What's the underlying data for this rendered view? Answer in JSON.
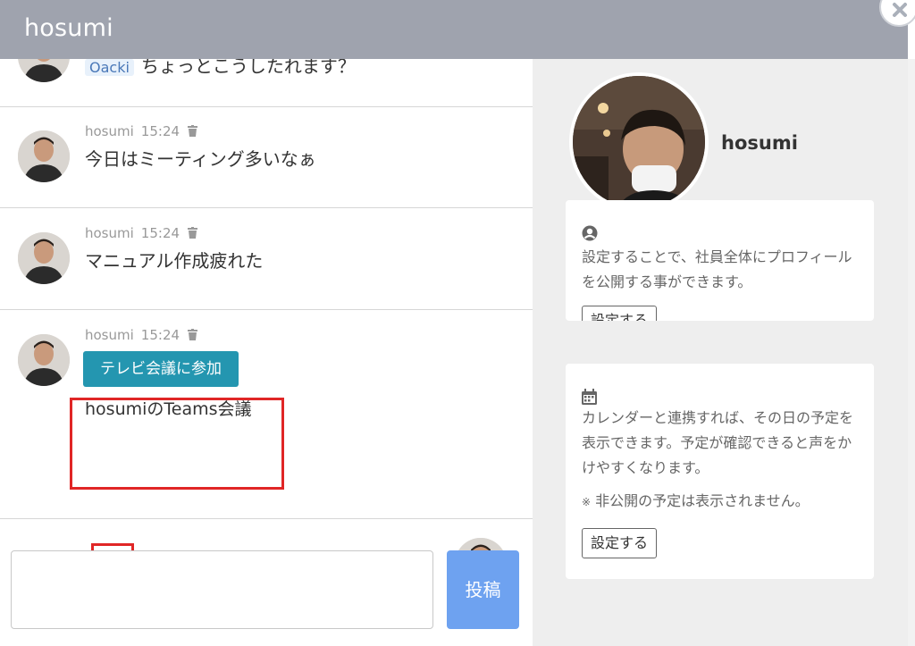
{
  "header": {
    "title": "hosumi"
  },
  "messages": [
    {
      "partial_tag": "Oacki",
      "partial_text": "ちょっとこうしたれます？"
    },
    {
      "author": "hosumi",
      "time": "15:24",
      "text": "今日はミーティング多いなぁ"
    },
    {
      "author": "hosumi",
      "time": "15:24",
      "text": "マニュアル作成疲れた"
    },
    {
      "author": "hosumi",
      "time": "15:24",
      "button_label": "テレビ会議に参加",
      "text": "hosumiのTeams会議"
    }
  ],
  "composer": {
    "tools": [
      "megaphone-icon",
      "smile-icon",
      "video-camera-icon",
      "user-icon",
      "paperclip-icon"
    ],
    "input_value": "",
    "post_label": "投稿"
  },
  "profile": {
    "name": "hosumi",
    "profile_card": {
      "icon": "user-circle-icon",
      "text": "設定することで、社員全体にプロフィールを公開する事ができます。",
      "button_label": "設定する"
    },
    "calendar_card": {
      "icon": "calendar-icon",
      "text": "カレンダーと連携すれば、その日の予定を表示できます。予定が確認できると声をかけやすくなります。",
      "note": "非公開の予定は表示されません。",
      "button_label": "設定する"
    }
  },
  "colors": {
    "header": "#9fa3ae",
    "join_button": "#2496b0",
    "post_button": "#6ea2f0",
    "highlight": "#e02626"
  }
}
